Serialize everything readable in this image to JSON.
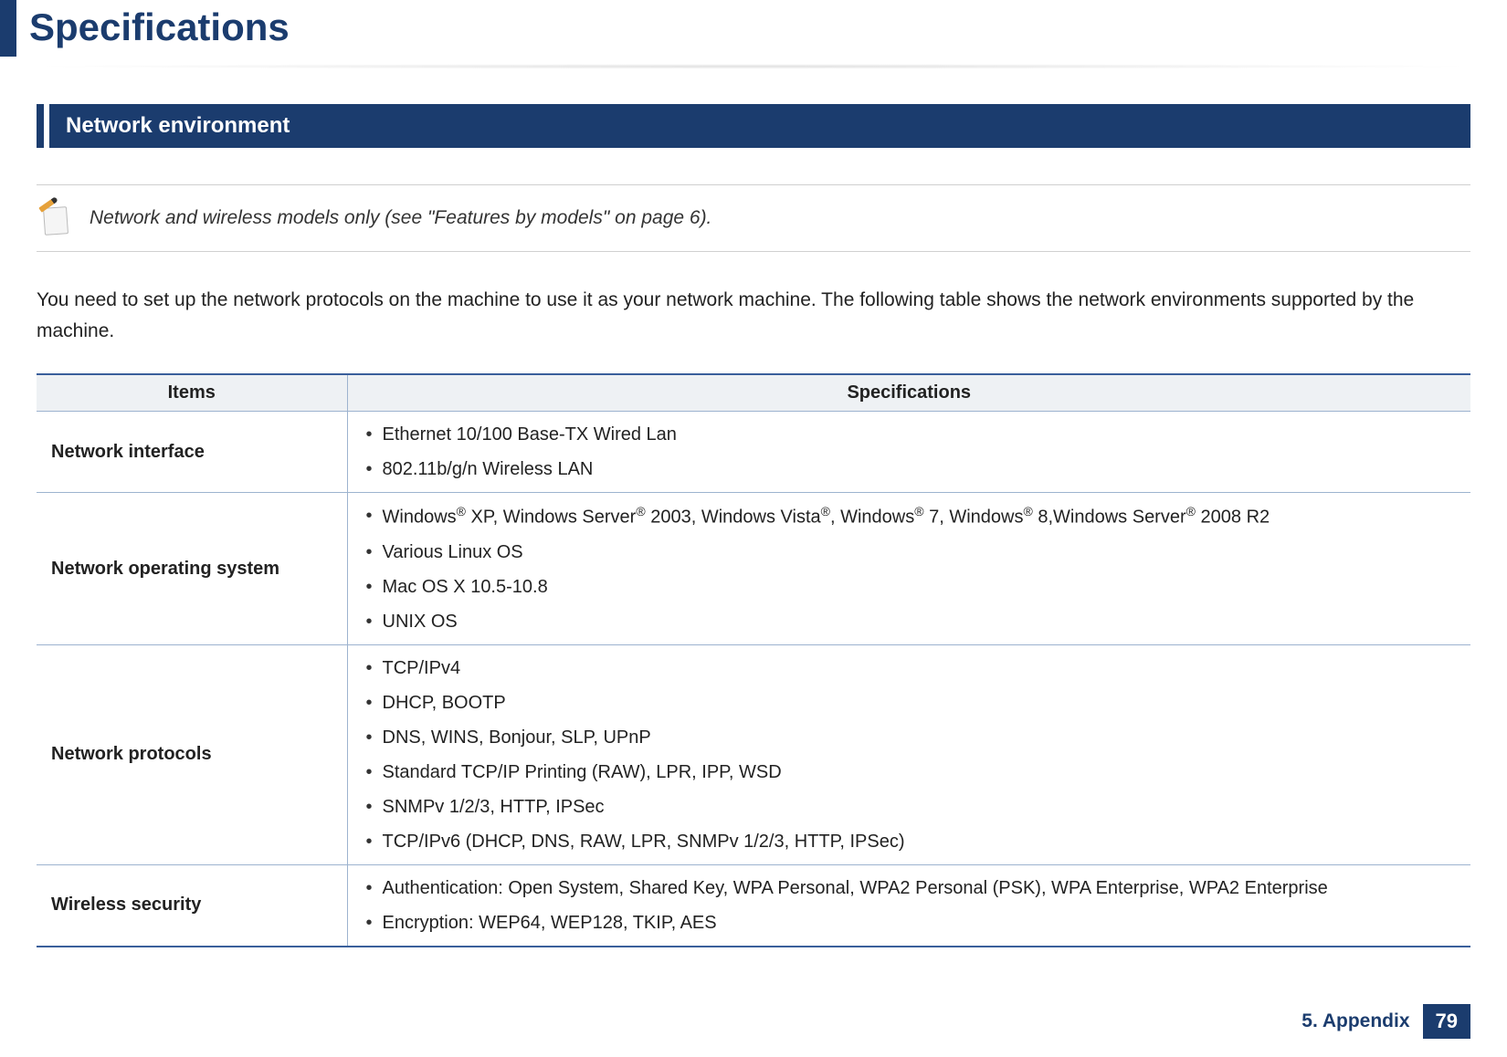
{
  "page": {
    "title": "Specifications",
    "section": "Network environment",
    "note": "Network and wireless models only (see \"Features by models\" on page 6).",
    "intro": "You need to set up the network protocols on the machine to use it as your network machine. The following table shows the network environments supported by the machine.",
    "footer_chapter": "5. Appendix",
    "footer_page": "79"
  },
  "table": {
    "headers": {
      "items": "Items",
      "specs": "Specifications"
    },
    "rows": [
      {
        "label": "Network interface",
        "specs": [
          "Ethernet 10/100 Base-TX Wired Lan",
          "802.11b/g/n Wireless LAN"
        ]
      },
      {
        "label": "Network operating system",
        "specs": [
          "Windows® XP, Windows Server® 2003, Windows Vista®, Windows® 7, Windows® 8,Windows Server® 2008 R2",
          "Various Linux OS",
          "Mac OS X 10.5-10.8",
          "UNIX OS"
        ]
      },
      {
        "label": "Network protocols",
        "specs": [
          "TCP/IPv4",
          "DHCP, BOOTP",
          "DNS, WINS, Bonjour, SLP, UPnP",
          "Standard TCP/IP Printing (RAW), LPR, IPP, WSD",
          "SNMPv 1/2/3, HTTP, IPSec",
          "TCP/IPv6 (DHCP, DNS, RAW, LPR, SNMPv 1/2/3, HTTP, IPSec)"
        ]
      },
      {
        "label": "Wireless security",
        "specs": [
          "Authentication: Open System, Shared Key, WPA Personal, WPA2 Personal (PSK), WPA Enterprise, WPA2 Enterprise",
          "Encryption: WEP64, WEP128, TKIP, AES"
        ]
      }
    ]
  }
}
